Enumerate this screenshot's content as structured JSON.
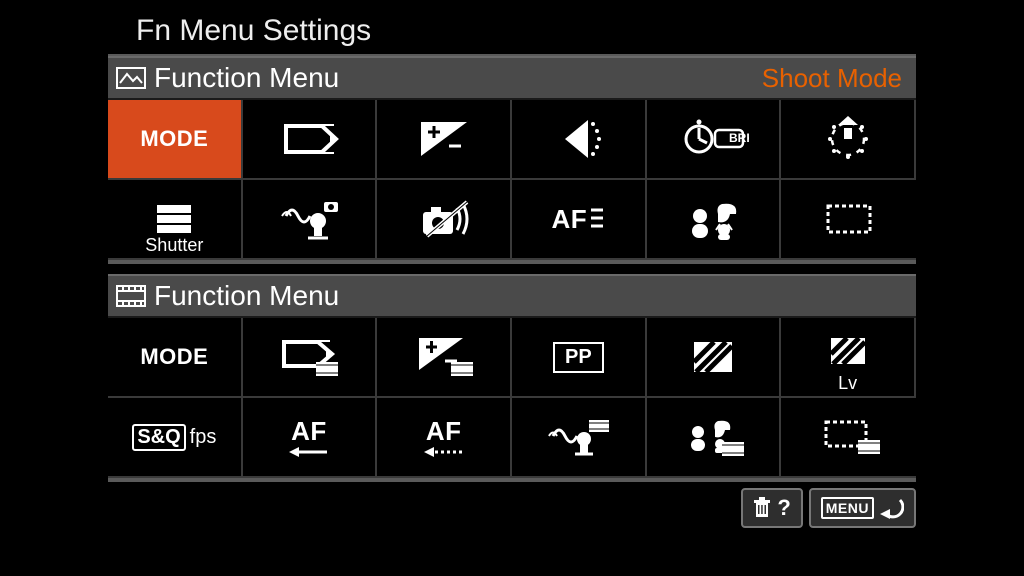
{
  "title": "Fn Menu Settings",
  "section_photo": {
    "title": "Function Menu",
    "right": "Shoot Mode"
  },
  "section_video": {
    "title": "Function Menu"
  },
  "photo_cells": [
    {
      "name": "shoot-mode",
      "text": "MODE",
      "selected": true
    },
    {
      "name": "file-format"
    },
    {
      "name": "exposure-comp"
    },
    {
      "name": "iso"
    },
    {
      "name": "bracket",
      "smalltext": "BRK"
    },
    {
      "name": "drive-mode"
    },
    {
      "name": "shutter-type",
      "label": "Shutter"
    },
    {
      "name": "steadyshot"
    },
    {
      "name": "silent-shooting"
    },
    {
      "name": "af-mode",
      "text": "AF",
      "extra": "stripes"
    },
    {
      "name": "subject-detection"
    },
    {
      "name": "focus-area"
    }
  ],
  "video_cells": [
    {
      "name": "shoot-mode",
      "text": "MODE"
    },
    {
      "name": "file-format-video"
    },
    {
      "name": "exposure-comp-video"
    },
    {
      "name": "picture-profile",
      "text": "PP",
      "framed": true
    },
    {
      "name": "zebra"
    },
    {
      "name": "zebra-lv",
      "label": "Lv"
    },
    {
      "name": "sq-fps",
      "text_html": "S&Q",
      "smalltext": "fps",
      "boxed": true
    },
    {
      "name": "af-transition",
      "text": "AF",
      "arrow": "solid"
    },
    {
      "name": "af-subj-shift",
      "text": "AF",
      "arrow": "dotted"
    },
    {
      "name": "steadyshot-video"
    },
    {
      "name": "subject-detection-video"
    },
    {
      "name": "focus-area-video"
    }
  ],
  "footer": {
    "help": "?",
    "menu": "MENU"
  }
}
